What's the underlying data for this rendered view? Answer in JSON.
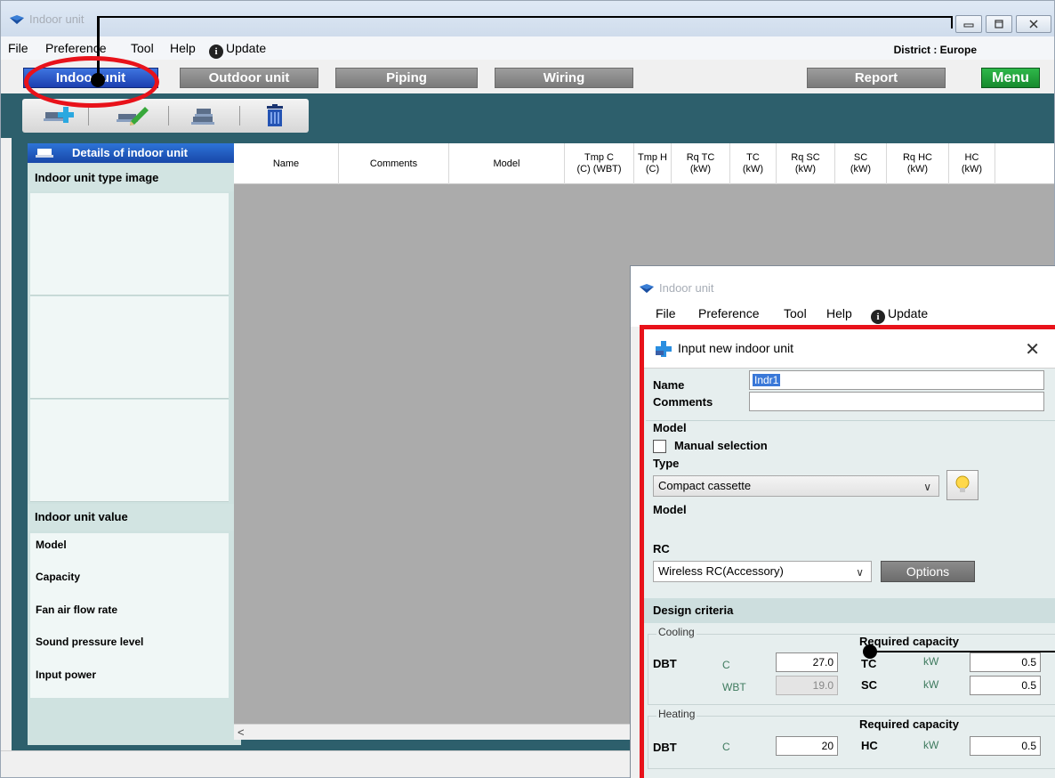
{
  "window": {
    "title": "Indoor unit",
    "menu": {
      "file": "File",
      "preference": "Preference",
      "tool": "Tool",
      "help": "Help",
      "update": "Update"
    },
    "district": "District : Europe"
  },
  "nav": {
    "indoor": "Indoor unit",
    "outdoor": "Outdoor unit",
    "piping": "Piping",
    "wiring": "Wiring",
    "report": "Report",
    "menu": "Menu"
  },
  "left_panel": {
    "header": "Details of indoor unit",
    "type_image": "Indoor unit type image",
    "value_header": "Indoor unit value",
    "values": [
      "Model",
      "Capacity",
      "Fan air flow rate",
      "Sound pressure level",
      "Input power"
    ]
  },
  "grid": {
    "columns": [
      {
        "line1": "Name",
        "line2": ""
      },
      {
        "line1": "Comments",
        "line2": ""
      },
      {
        "line1": "Model",
        "line2": ""
      },
      {
        "line1": "Tmp C",
        "line2": "(C) (WBT)"
      },
      {
        "line1": "Tmp H",
        "line2": "(C)"
      },
      {
        "line1": "Rq TC",
        "line2": "(kW)"
      },
      {
        "line1": "TC",
        "line2": "(kW)"
      },
      {
        "line1": "Rq SC",
        "line2": "(kW)"
      },
      {
        "line1": "SC",
        "line2": "(kW)"
      },
      {
        "line1": "Rq HC",
        "line2": "(kW)"
      },
      {
        "line1": "HC",
        "line2": "(kW)"
      }
    ],
    "scroll_left": "<"
  },
  "overlay": {
    "title": "Indoor unit",
    "menu": {
      "file": "File",
      "preference": "Preference",
      "tool": "Tool",
      "help": "Help",
      "update": "Update"
    }
  },
  "dialog": {
    "title": "Input new indoor unit",
    "close": "✕",
    "name_label": "Name",
    "name_value": "Indr1",
    "comments_label": "Comments",
    "comments_value": "",
    "model_section": "Model",
    "manual_selection": "Manual selection",
    "type_label": "Type",
    "type_value": "Compact cassette",
    "model_label": "Model",
    "rc_label": "RC",
    "rc_value": "Wireless RC(Accessory)",
    "options": "Options",
    "design_criteria": "Design criteria",
    "cooling": {
      "caption": "Cooling",
      "required_capacity": "Required capacity",
      "dbt_label": "DBT",
      "dbt_unit": "C",
      "dbt_value": "27.0",
      "wbt_unit": "WBT",
      "wbt_value": "19.0",
      "tc_label": "TC",
      "tc_unit": "kW",
      "tc_value": "0.5",
      "sc_label": "SC",
      "sc_unit": "kW",
      "sc_value": "0.5"
    },
    "heating": {
      "caption": "Heating",
      "required_capacity": "Required capacity",
      "dbt_label": "DBT",
      "dbt_unit": "C",
      "dbt_value": "20",
      "hc_label": "HC",
      "hc_unit": "kW",
      "hc_value": "0.5"
    }
  },
  "colors": {
    "toolbar": "#2d5f6c",
    "nav_active": "#1c3fb0",
    "menu_green": "#168a2e",
    "highlight_red": "#e8121a",
    "grid_bg": "#ababab"
  },
  "icons": [
    "app-icon",
    "minimize-icon",
    "maximize-icon",
    "close-icon",
    "update-info-icon",
    "add-unit-icon",
    "edit-unit-icon",
    "copy-unit-icon",
    "delete-icon",
    "indoor-unit-icon",
    "plus-icon",
    "bulb-icon",
    "dropdown-chevron-icon"
  ]
}
